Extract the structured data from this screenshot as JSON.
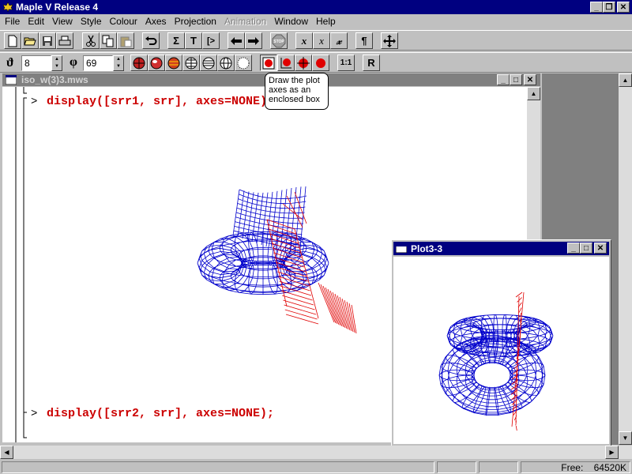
{
  "app": {
    "title": "Maple V Release 4"
  },
  "menu": [
    "File",
    "Edit",
    "View",
    "Style",
    "Colour",
    "Axes",
    "Projection",
    "Animation",
    "Window",
    "Help"
  ],
  "menu_disabled": [
    "Animation"
  ],
  "toolbar": {
    "buttons": [
      "new-file-icon",
      "open-file-icon",
      "save-icon",
      "print-icon",
      "cut-icon",
      "copy-icon",
      "paste-icon",
      "undo-icon",
      "sigma-icon",
      "text-icon",
      "exec-group-icon",
      "outdent-icon",
      "indent-icon",
      "stop-icon",
      "x-italic-icon",
      "x-math-icon",
      "x-script-icon",
      "pilcrow-icon",
      "move-icon"
    ],
    "sigma": "Σ",
    "text": "T",
    "exec": "[>",
    "stop": "STOP",
    "x_italic": "x",
    "x_math": "x",
    "x_script": "𝓍",
    "pilcrow": "¶"
  },
  "plot_toolbar": {
    "theta_symbol": "ϑ",
    "theta_value": "8",
    "phi_symbol": "φ",
    "phi_value": "69",
    "scale_label": "1:1",
    "redraw_label": "R"
  },
  "tooltip": {
    "line1": "Draw the plot",
    "line2": "axes as an",
    "line3": "enclosed box"
  },
  "worksheet": {
    "title": "iso_w(3)3.mws",
    "prompt1": ">",
    "cmd1": "display([srr1, srr], axes=NONE);",
    "prompt2": ">",
    "cmd2": "display([srr2, srr], axes=NONE);"
  },
  "plot_window": {
    "title": "Plot3-3"
  },
  "status": {
    "free_label": "Free:",
    "free_value": "64520K"
  },
  "colors": {
    "mesh_blue": "#0000cc",
    "mesh_red": "#e00000",
    "code_red": "#cc0000",
    "title_active": "#000080",
    "title_inactive": "#808080"
  }
}
